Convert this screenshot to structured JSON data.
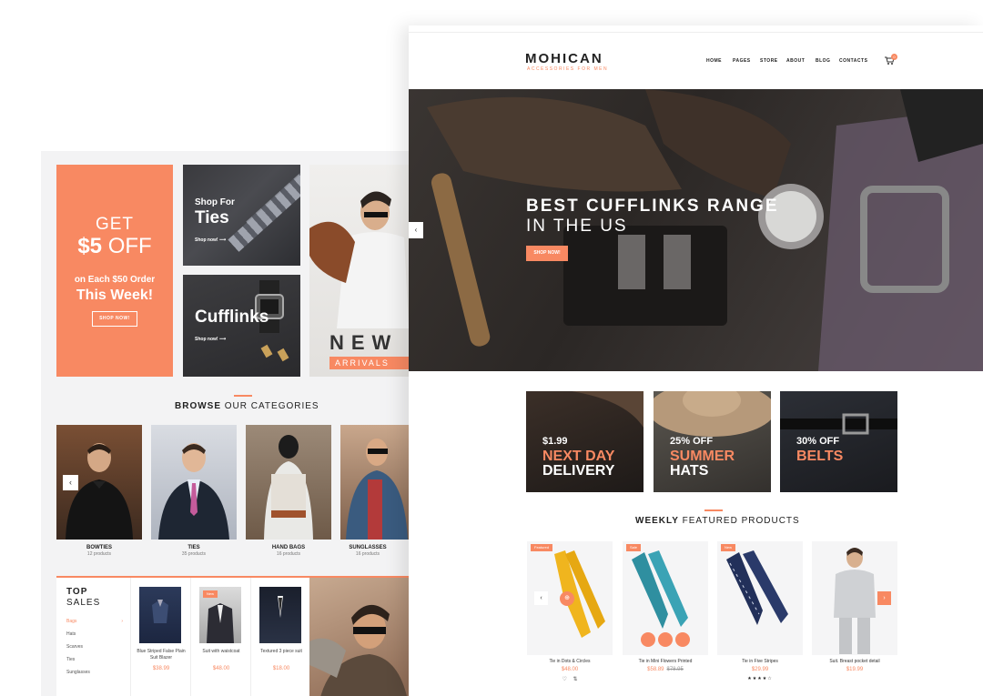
{
  "left": {
    "promo": {
      "get": "GET",
      "amount": "$5",
      "off": "OFF",
      "each": "on Each $50 Order",
      "week": "This Week!",
      "button": "SHOP NOW!"
    },
    "tiles": {
      "ties": {
        "kicker": "Shop For",
        "title": "Ties",
        "link": "Shop now! ⟶"
      },
      "cufflinks": {
        "title": "Cufflinks",
        "link": "Shop now! ⟶"
      },
      "new": {
        "word": "NEW",
        "sub": "ARRIVALS"
      }
    },
    "browse": {
      "bold": "BROWSE",
      "rest": "OUR CATEGORIES"
    },
    "categories": [
      {
        "name": "BOWTIES",
        "count": "12 products"
      },
      {
        "name": "TIES",
        "count": "35 products"
      },
      {
        "name": "HAND BAGS",
        "count": "16 products"
      },
      {
        "name": "SUNGLASSES",
        "count": "16 products"
      }
    ],
    "top_sales": {
      "title": "TOP",
      "subtitle": "SALES",
      "menu": [
        "Bags",
        "Hats",
        "Scarves",
        "Ties",
        "Sunglasses"
      ],
      "active_arrow": "›",
      "products": [
        {
          "name": "Blue Striped False Plain Suit Blazer",
          "price": "$38.99"
        },
        {
          "name": "Suit with waistcoat",
          "price": "$48.00",
          "badge": "New"
        },
        {
          "name": "Textured 3 piece suit",
          "price": "$18.00"
        }
      ]
    }
  },
  "right": {
    "logo": "MOHICAN",
    "logo_sub": "ACCESSORIES FOR MEN",
    "nav": [
      "HOME",
      "PAGES",
      "STORE",
      "ABOUT",
      "BLOG",
      "CONTACTS"
    ],
    "cart_count": "0",
    "hero": {
      "line1": "BEST CUFFLINKS RANGE",
      "line2": "IN THE US",
      "button": "SHOP NOW!"
    },
    "banners": [
      {
        "l1": "$1.99",
        "l2": "NEXT DAY",
        "l3": "DELIVERY"
      },
      {
        "l1": "25% OFF",
        "l2": "SUMMER",
        "l3": "HATS"
      },
      {
        "l1": "30% OFF",
        "l2": "BELTS",
        "l3": ""
      }
    ],
    "featured": {
      "bold": "WEEKLY",
      "rest": "FEATURED PRODUCTS"
    },
    "products": [
      {
        "badge": "Featured",
        "name": "Tie in Dots & Circles",
        "price": "$48.00",
        "old": ""
      },
      {
        "badge": "Sale",
        "name": "Tie in Mini Flowers Printed",
        "price": "$58.89",
        "old": "$78.95"
      },
      {
        "badge": "New",
        "name": "Tie in Five Stripes",
        "price": "$29.99",
        "old": "",
        "stars": "★★★★☆"
      },
      {
        "badge": "",
        "name": "Suit. Breast pocket detail",
        "price": "$19.99",
        "old": ""
      }
    ]
  },
  "colors": {
    "accent": "#f88962",
    "dark": "#222222"
  },
  "icons": {
    "cart": "cart-icon",
    "arrow_left": "chevron-left-icon",
    "arrow_right": "chevron-right-icon",
    "heart": "heart-icon",
    "compare": "compare-icon"
  }
}
